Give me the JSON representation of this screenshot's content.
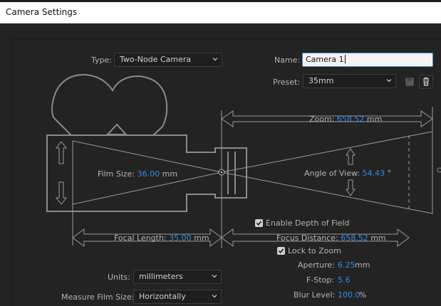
{
  "window": {
    "title": "Camera Settings"
  },
  "type": {
    "label": "Type:",
    "value": "Two-Node Camera"
  },
  "name": {
    "label": "Name:",
    "value": "Camera 1"
  },
  "preset": {
    "label": "Preset:",
    "value": "35mm"
  },
  "diagram": {
    "zoom": {
      "label": "Zoom:",
      "value": "658.52",
      "unit": "mm"
    },
    "film_size": {
      "label": "Film Size:",
      "value": "36.00",
      "unit": "mm"
    },
    "angle_of_view": {
      "label": "Angle of View:",
      "value": "54.43",
      "unit": "°"
    },
    "focal_length": {
      "label": "Focal Length:",
      "value": "35.00",
      "unit": "mm"
    },
    "focus_distance": {
      "label": "Focus Distance:",
      "value": "658.52",
      "unit": "mm"
    }
  },
  "enable_dof": {
    "label": "Enable Depth of Field",
    "checked": true
  },
  "lock_to_zoom": {
    "label": "Lock to Zoom",
    "checked": true
  },
  "aperture": {
    "label": "Aperture:",
    "value": "6.25",
    "unit": "mm"
  },
  "fstop": {
    "label": "F-Stop:",
    "value": "5.6"
  },
  "blur_level": {
    "label": "Blur Level:",
    "value": "100.0",
    "unit": "%"
  },
  "units": {
    "label": "Units:",
    "value": "millimeters"
  },
  "measure_film_size": {
    "label": "Measure Film Size:",
    "value": "Horizontally"
  },
  "icons": [
    "chevron-down-icon",
    "save-preset-icon",
    "trash-icon",
    "checkbox-checked-icon",
    "arrow-icon"
  ]
}
